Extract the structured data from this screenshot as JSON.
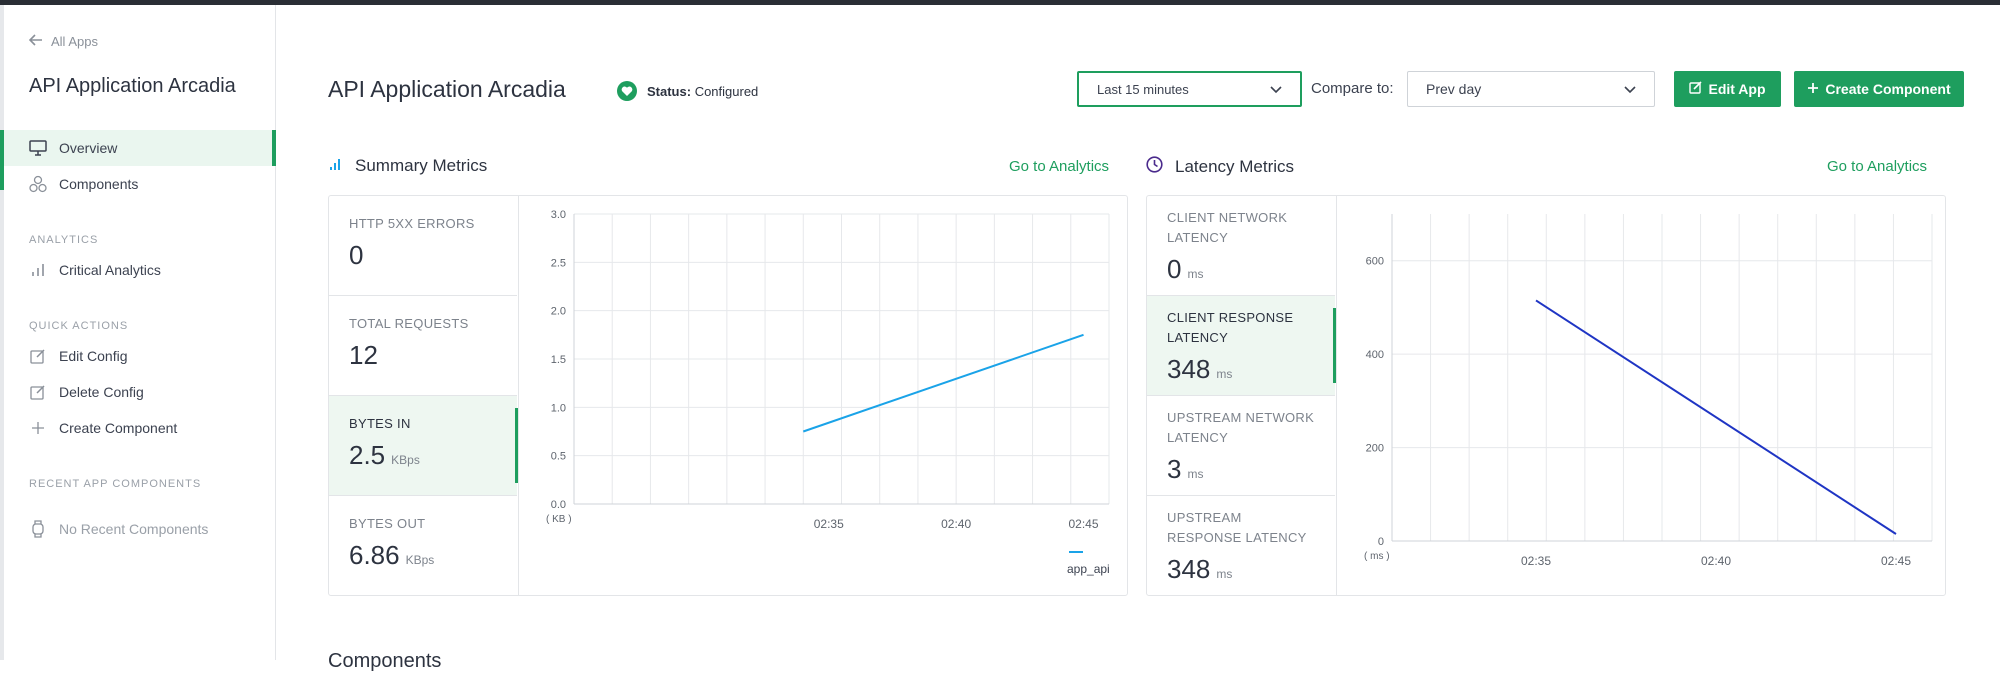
{
  "sidebar": {
    "back_label": "All Apps",
    "app_title": "API Application Arcadia",
    "nav": [
      {
        "label": "Overview",
        "icon": "monitor-icon"
      },
      {
        "label": "Components",
        "icon": "components-icon"
      }
    ],
    "analytics_label": "ANALYTICS",
    "analytics_items": [
      {
        "label": "Critical Analytics",
        "icon": "bar-chart-icon"
      }
    ],
    "quick_actions_label": "QUICK ACTIONS",
    "quick_actions": [
      {
        "label": "Edit Config",
        "icon": "edit-icon"
      },
      {
        "label": "Delete Config",
        "icon": "edit-icon"
      },
      {
        "label": "Create Component",
        "icon": "plus-icon"
      }
    ],
    "recent_label": "RECENT APP COMPONENTS",
    "recent_empty": "No Recent Components"
  },
  "header": {
    "title": "API Application Arcadia",
    "status_label": "Status:",
    "status_value": "Configured",
    "time_range": "Last 15 minutes",
    "compare_label": "Compare to:",
    "compare_value": "Prev day",
    "edit_button": "Edit App",
    "create_button": "Create Component"
  },
  "summary": {
    "title": "Summary Metrics",
    "link": "Go to Analytics",
    "metrics": [
      {
        "label": "HTTP 5XX ERRORS",
        "value": "0",
        "unit": ""
      },
      {
        "label": "TOTAL REQUESTS",
        "value": "12",
        "unit": ""
      },
      {
        "label": "BYTES IN",
        "value": "2.5",
        "unit": "KBps"
      },
      {
        "label": "BYTES OUT",
        "value": "6.86",
        "unit": "KBps"
      }
    ]
  },
  "latency": {
    "title": "Latency Metrics",
    "link": "Go to Analytics",
    "metrics": [
      {
        "label": "CLIENT NETWORK LATENCY",
        "value": "0",
        "unit": "ms"
      },
      {
        "label": "CLIENT RESPONSE LATENCY",
        "value": "348",
        "unit": "ms"
      },
      {
        "label": "UPSTREAM NETWORK LATENCY",
        "value": "3",
        "unit": "ms"
      },
      {
        "label": "UPSTREAM RESPONSE LATENCY",
        "value": "348",
        "unit": "ms"
      }
    ]
  },
  "bottom_heading": "Components",
  "colors": {
    "accent": "#1e9e5e",
    "bytes_line": "#1aa3e8",
    "latency_line": "#1f35c4"
  },
  "chart_data": [
    {
      "type": "line",
      "unit_label": "( KB )",
      "ylim": [
        0,
        3.0
      ],
      "yticks": [
        "0.0",
        "0.5",
        "1.0",
        "1.5",
        "2.0",
        "2.5",
        "3.0"
      ],
      "xticks": [
        "02:35",
        "02:40",
        "02:45"
      ],
      "series": [
        {
          "name": "app_api",
          "points": [
            {
              "x": "02:34",
              "y": 0.75
            },
            {
              "x": "02:45",
              "y": 1.75
            }
          ]
        }
      ]
    },
    {
      "type": "line",
      "unit_label": "( ms )",
      "ylim": [
        0,
        700
      ],
      "yticks": [
        "0",
        "200",
        "400",
        "600"
      ],
      "xticks": [
        "02:35",
        "02:40",
        "02:45"
      ],
      "series": [
        {
          "points": [
            {
              "x": "02:35",
              "y": 515
            },
            {
              "x": "02:45",
              "y": 15
            }
          ]
        }
      ]
    }
  ]
}
